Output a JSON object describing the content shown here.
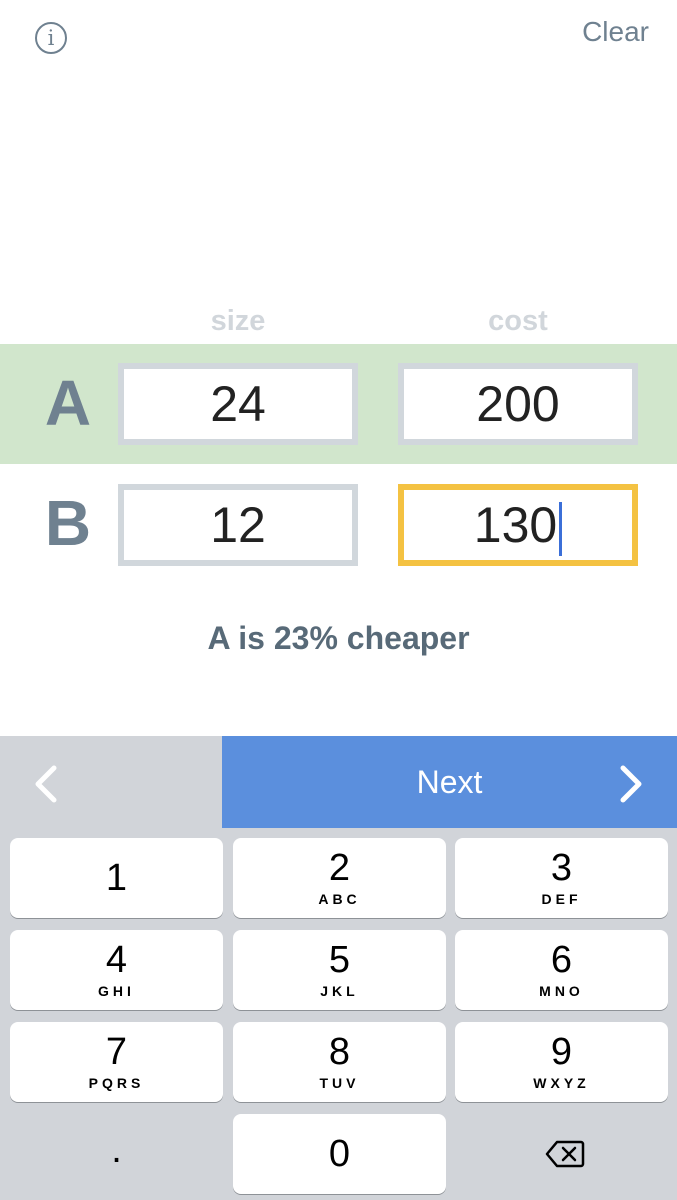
{
  "header": {
    "info_label": "i",
    "clear_label": "Clear"
  },
  "columns": {
    "size_label": "size",
    "cost_label": "cost"
  },
  "rows": [
    {
      "letter": "A",
      "size": "24",
      "cost": "200"
    },
    {
      "letter": "B",
      "size": "12",
      "cost": "130"
    }
  ],
  "result": "A is 23% cheaper",
  "toolbar": {
    "prev_icon": "chevron-left-icon",
    "next_label": "Next",
    "next_icon": "chevron-right-icon"
  },
  "keypad": {
    "keys": [
      {
        "digit": "1",
        "letters": ""
      },
      {
        "digit": "2",
        "letters": "ABC"
      },
      {
        "digit": "3",
        "letters": "DEF"
      },
      {
        "digit": "4",
        "letters": "GHI"
      },
      {
        "digit": "5",
        "letters": "JKL"
      },
      {
        "digit": "6",
        "letters": "MNO"
      },
      {
        "digit": "7",
        "letters": "PQRS"
      },
      {
        "digit": "8",
        "letters": "TUV"
      },
      {
        "digit": "9",
        "letters": "WXYZ"
      },
      {
        "digit": "0",
        "letters": ""
      }
    ],
    "decimal": ".",
    "delete_icon": "backspace-icon"
  },
  "colors": {
    "accent": "#5b8fdd",
    "row_a_bg": "#d1e6cc",
    "active_border": "#f4c242",
    "text_muted": "#6f8190"
  }
}
